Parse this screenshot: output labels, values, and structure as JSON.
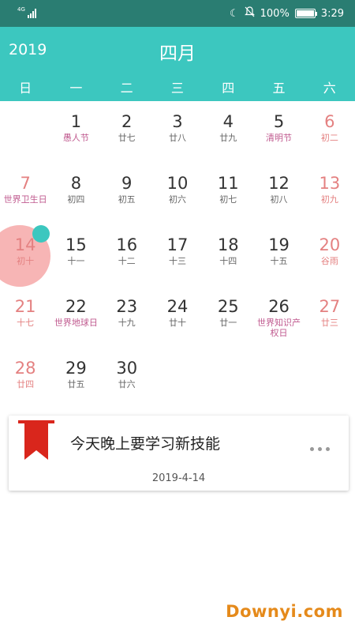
{
  "status_bar": {
    "network": "4G",
    "battery": "100%",
    "battery_level": 1.0,
    "time": "3:29",
    "icons": [
      "signal-icon",
      "moon-icon",
      "bell-off-icon",
      "battery-icon"
    ]
  },
  "header": {
    "year": "2019",
    "month": "四月",
    "weekdays": [
      "日",
      "一",
      "二",
      "三",
      "四",
      "五",
      "六"
    ]
  },
  "colors": {
    "header": "#3cc7bf",
    "status_bar": "#2a7d72",
    "weekend": "#e48181",
    "festival": "#c05a8f",
    "today_highlight": "#f7b5b5",
    "bookmark": "#d9261c",
    "watermark": "#e58a1b"
  },
  "calendar": {
    "selected_day": "14",
    "weeks": [
      [
        null,
        {
          "day": "1",
          "sub": "愚人节",
          "festival": true
        },
        {
          "day": "2",
          "sub": "廿七"
        },
        {
          "day": "3",
          "sub": "廿八"
        },
        {
          "day": "4",
          "sub": "廿九"
        },
        {
          "day": "5",
          "sub": "清明节",
          "festival": true
        },
        {
          "day": "6",
          "sub": "初二"
        }
      ],
      [
        {
          "day": "7",
          "sub": "世界卫生日",
          "festival": true
        },
        {
          "day": "8",
          "sub": "初四"
        },
        {
          "day": "9",
          "sub": "初五"
        },
        {
          "day": "10",
          "sub": "初六"
        },
        {
          "day": "11",
          "sub": "初七"
        },
        {
          "day": "12",
          "sub": "初八"
        },
        {
          "day": "13",
          "sub": "初九"
        }
      ],
      [
        {
          "day": "14",
          "sub": "初十"
        },
        {
          "day": "15",
          "sub": "十一"
        },
        {
          "day": "16",
          "sub": "十二"
        },
        {
          "day": "17",
          "sub": "十三"
        },
        {
          "day": "18",
          "sub": "十四"
        },
        {
          "day": "19",
          "sub": "十五"
        },
        {
          "day": "20",
          "sub": "谷雨"
        }
      ],
      [
        {
          "day": "21",
          "sub": "十七"
        },
        {
          "day": "22",
          "sub": "世界地球日",
          "festival": true
        },
        {
          "day": "23",
          "sub": "十九"
        },
        {
          "day": "24",
          "sub": "廿十"
        },
        {
          "day": "25",
          "sub": "廿一"
        },
        {
          "day": "26",
          "sub": "世界知识产",
          "sub2": "权日",
          "festival": true
        },
        {
          "day": "27",
          "sub": "廿三"
        }
      ],
      [
        {
          "day": "28",
          "sub": "廿四"
        },
        {
          "day": "29",
          "sub": "廿五"
        },
        {
          "day": "30",
          "sub": "廿六"
        },
        null,
        null,
        null,
        null
      ]
    ]
  },
  "note": {
    "text": "今天晚上要学习新技能",
    "date": "2019-4-14",
    "icon": "bookmark-icon",
    "menu_icon": "more-icon"
  },
  "watermark": "Downyi.com"
}
